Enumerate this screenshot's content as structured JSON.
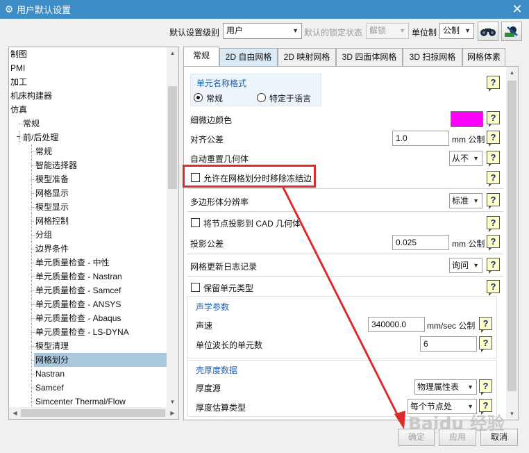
{
  "window": {
    "title": "用户默认设置",
    "close_label": "✕"
  },
  "toolbar": {
    "level_label": "默认设置级别",
    "level_value": "用户",
    "lock_label": "默认的锁定状态",
    "lock_value": "解锁",
    "unit_label": "单位制",
    "unit_value": "公制"
  },
  "tree": {
    "items": [
      "制图",
      "PMI",
      "加工",
      "机床构建器",
      "仿真",
      "常规",
      "前/后处理",
      "常规",
      "智能选择器",
      "模型准备",
      "网格显示",
      "模型显示",
      "网格控制",
      "分组",
      "边界条件",
      "单元质量检查 - 中性",
      "单元质量检查 - Nastran",
      "单元质量检查 - Samcef",
      "单元质量检查 - ANSYS",
      "单元质量检查 - Abaqus",
      "单元质量检查 - LS-DYNA",
      "模型清理",
      "网格划分",
      "Nastran",
      "Samcef",
      "Simcenter Thermal/Flow"
    ],
    "expander": "−"
  },
  "tabs": [
    "常规",
    "2D 自由网格",
    "2D 映射网格",
    "3D 四面体网格",
    "3D 扫掠网格",
    "网格体素"
  ],
  "form": {
    "elem_name_group": "单元名称格式",
    "radio_normal": "常规",
    "radio_lang": "特定于语言",
    "thin_edge_color_label": "细微边颜色",
    "thin_edge_color": "#ff00ff",
    "align_tol_label": "对齐公差",
    "align_tol_value": "1.0",
    "align_tol_unit": "mm 公制",
    "auto_reset_label": "自动重置几何体",
    "auto_reset_value": "从不",
    "allow_remove_label": "允许在网格划分时移除冻结边",
    "polygon_res_label": "多边形体分辨率",
    "polygon_res_value": "标准",
    "project_nodes_label": "将节点投影到 CAD 几何体",
    "proj_tol_label": "投影公差",
    "proj_tol_value": "0.025",
    "proj_tol_unit": "mm 公制",
    "log_label": "网格更新日志记录",
    "log_value": "询问",
    "keep_elem_label": "保留单元类型",
    "acoustic_group": "声学参数",
    "sound_speed_label": "声速",
    "sound_speed_value": "340000.0",
    "sound_speed_unit": "mm/sec 公制",
    "elems_per_wave_label": "单位波长的单元数",
    "elems_per_wave_value": "6",
    "shell_group": "壳厚度数据",
    "thickness_src_label": "厚度源",
    "thickness_src_value": "物理属性表",
    "thickness_est_label": "厚度估算类型",
    "thickness_est_value": "每个节点处",
    "help_glyph": "?"
  },
  "buttons": {
    "ok": "确定",
    "apply": "应用",
    "cancel": "取消"
  },
  "watermark": "Baidu 经验"
}
